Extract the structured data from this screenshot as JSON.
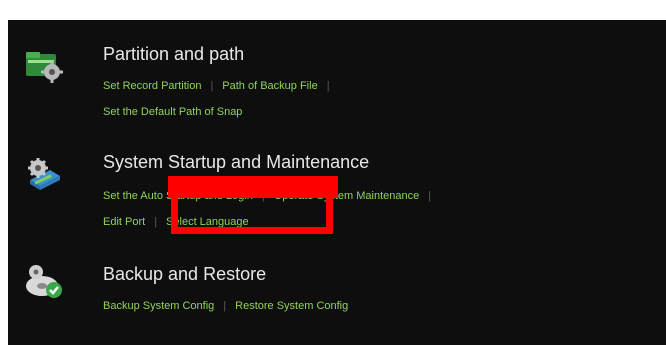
{
  "sections": [
    {
      "title": "Partition and path",
      "icon": "partition-folder-gear-icon",
      "rows": [
        [
          "Set Record Partition",
          "Path of Backup File",
          ""
        ],
        [
          "Set the Default Path of Snap"
        ]
      ]
    },
    {
      "title": "System Startup and Maintenance",
      "icon": "system-maintenance-gear-icon",
      "rows": [
        [
          "Set the Auto Startup and Login",
          "Operate System Maintenance",
          ""
        ],
        [
          "Edit Port",
          "Select Language"
        ]
      ]
    },
    {
      "title": "Backup and Restore",
      "icon": "backup-restore-disc-icon",
      "rows": [
        [
          "Backup System Config",
          "Restore System Config"
        ]
      ]
    }
  ],
  "colors": {
    "panel_bg": "#0e0e0e",
    "title": "#e8e8e8",
    "link": "#8fd45a",
    "separator": "#5a5a5a",
    "highlight": "#ff0000"
  }
}
